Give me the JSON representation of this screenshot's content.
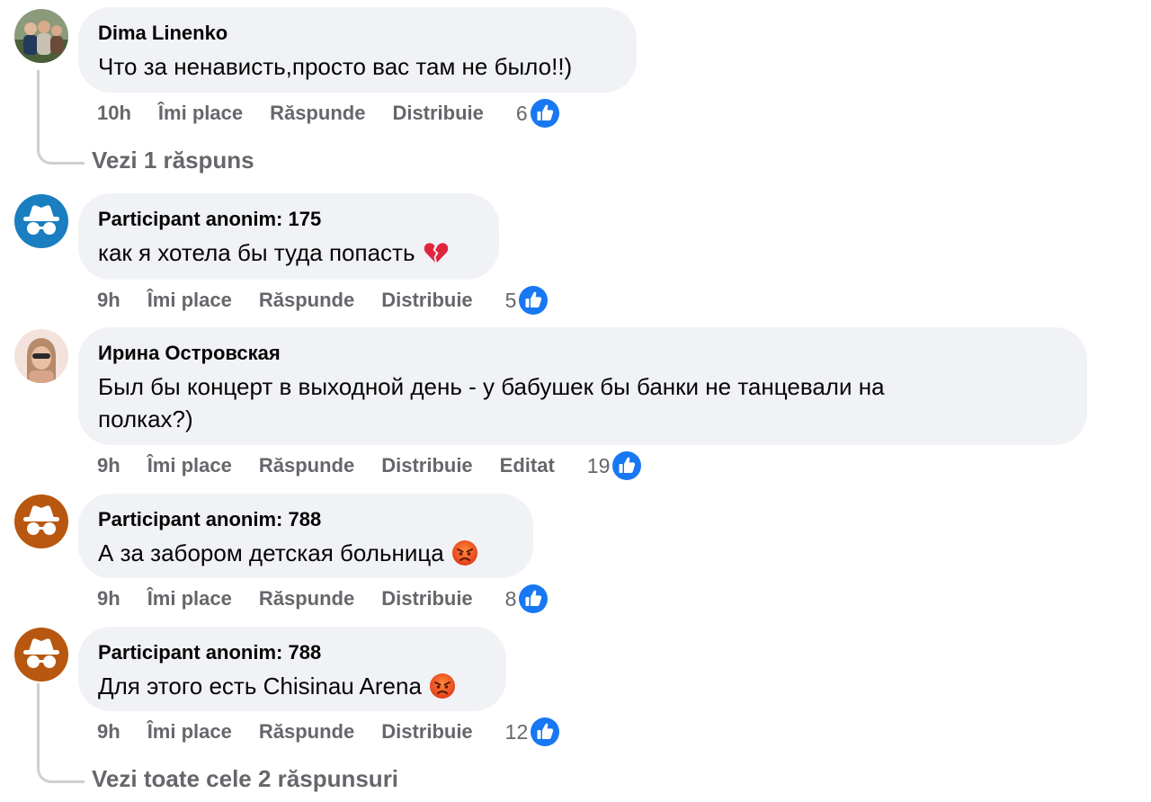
{
  "colors": {
    "like_blue": "#1877f2",
    "bubble_bg": "#f0f2f5",
    "muted": "#65676b",
    "anon_blue": "#1a7ec0",
    "anon_orange": "#b8570f"
  },
  "comments": [
    {
      "author": "Dima Linenko",
      "text": "Что за ненависть,просто вас там не было!!)",
      "time": "10h",
      "like_label": "Îmi place",
      "reply_label": "Răspunde",
      "share_label": "Distribuie",
      "likes": "6",
      "replies_link": "Vezi 1 răspuns"
    },
    {
      "author": "Participant anonim: 175",
      "text": "как я хотела бы туда попасть",
      "emoji": "broken-heart-icon",
      "time": "9h",
      "like_label": "Îmi place",
      "reply_label": "Răspunde",
      "share_label": "Distribuie",
      "likes": "5"
    },
    {
      "author": "Ирина Островская",
      "text_line1": "Был бы концерт в выходной день - у бабушек бы банки не танцевали на",
      "text_line2": "полках?)",
      "time": "9h",
      "like_label": "Îmi place",
      "reply_label": "Răspunde",
      "share_label": "Distribuie",
      "edited_label": "Editat",
      "likes": "19"
    },
    {
      "author": "Participant anonim: 788",
      "text": "А за забором детская больница",
      "emoji": "angry-face-icon",
      "time": "9h",
      "like_label": "Îmi place",
      "reply_label": "Răspunde",
      "share_label": "Distribuie",
      "likes": "8"
    },
    {
      "author": "Participant anonim: 788",
      "text": "Для этого есть Chisinau Arena",
      "emoji": "angry-face-icon",
      "time": "9h",
      "like_label": "Îmi place",
      "reply_label": "Răspunde",
      "share_label": "Distribuie",
      "likes": "12",
      "replies_link": "Vezi toate cele 2 răspunsuri"
    }
  ]
}
